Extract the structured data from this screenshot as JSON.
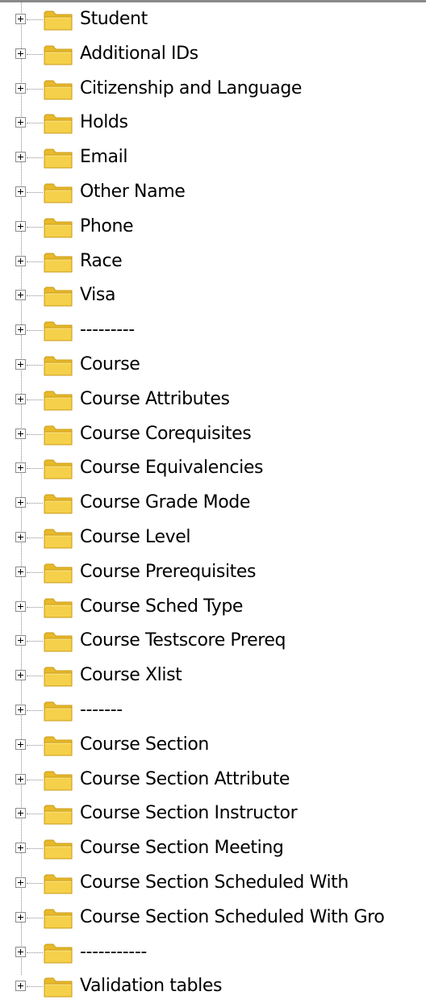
{
  "tree": {
    "nodes": [
      {
        "label": "Student",
        "icon": "folder-icon",
        "expanded": false
      },
      {
        "label": "Additional IDs",
        "icon": "folder-icon",
        "expanded": false
      },
      {
        "label": "Citizenship and Language",
        "icon": "folder-icon",
        "expanded": false
      },
      {
        "label": "Holds",
        "icon": "folder-icon",
        "expanded": false
      },
      {
        "label": "Email",
        "icon": "folder-icon",
        "expanded": false
      },
      {
        "label": "Other Name",
        "icon": "folder-icon",
        "expanded": false
      },
      {
        "label": "Phone",
        "icon": "folder-icon",
        "expanded": false
      },
      {
        "label": "Race",
        "icon": "folder-icon",
        "expanded": false
      },
      {
        "label": "Visa",
        "icon": "folder-icon",
        "expanded": false
      },
      {
        "label": "---------",
        "icon": "folder-icon",
        "expanded": false
      },
      {
        "label": "Course",
        "icon": "folder-icon",
        "expanded": false
      },
      {
        "label": "Course Attributes",
        "icon": "folder-icon",
        "expanded": false
      },
      {
        "label": "Course Corequisites",
        "icon": "folder-icon",
        "expanded": false
      },
      {
        "label": "Course Equivalencies",
        "icon": "folder-icon",
        "expanded": false
      },
      {
        "label": "Course Grade Mode",
        "icon": "folder-icon",
        "expanded": false
      },
      {
        "label": "Course Level",
        "icon": "folder-icon",
        "expanded": false
      },
      {
        "label": "Course Prerequisites",
        "icon": "folder-icon",
        "expanded": false
      },
      {
        "label": "Course Sched Type",
        "icon": "folder-icon",
        "expanded": false
      },
      {
        "label": "Course Testscore Prereq",
        "icon": "folder-icon",
        "expanded": false
      },
      {
        "label": "Course Xlist",
        "icon": "folder-icon",
        "expanded": false
      },
      {
        "label": "-------",
        "icon": "folder-icon",
        "expanded": false
      },
      {
        "label": "Course Section",
        "icon": "folder-icon",
        "expanded": false
      },
      {
        "label": "Course Section Attribute",
        "icon": "folder-icon",
        "expanded": false
      },
      {
        "label": "Course Section Instructor",
        "icon": "folder-icon",
        "expanded": false
      },
      {
        "label": "Course Section Meeting",
        "icon": "folder-icon",
        "expanded": false
      },
      {
        "label": "Course Section Scheduled With",
        "icon": "folder-icon",
        "expanded": false
      },
      {
        "label": "Course Section Scheduled With Gro",
        "icon": "folder-icon",
        "expanded": false
      },
      {
        "label": "-----------",
        "icon": "folder-icon",
        "expanded": false
      },
      {
        "label": "Validation tables",
        "icon": "folder-icon",
        "expanded": false
      }
    ]
  },
  "colors": {
    "folder_body": "#f5d04a",
    "folder_tab": "#e8b92a",
    "folder_outline": "#c99a16",
    "tree_lines": "#8c8c8c"
  }
}
